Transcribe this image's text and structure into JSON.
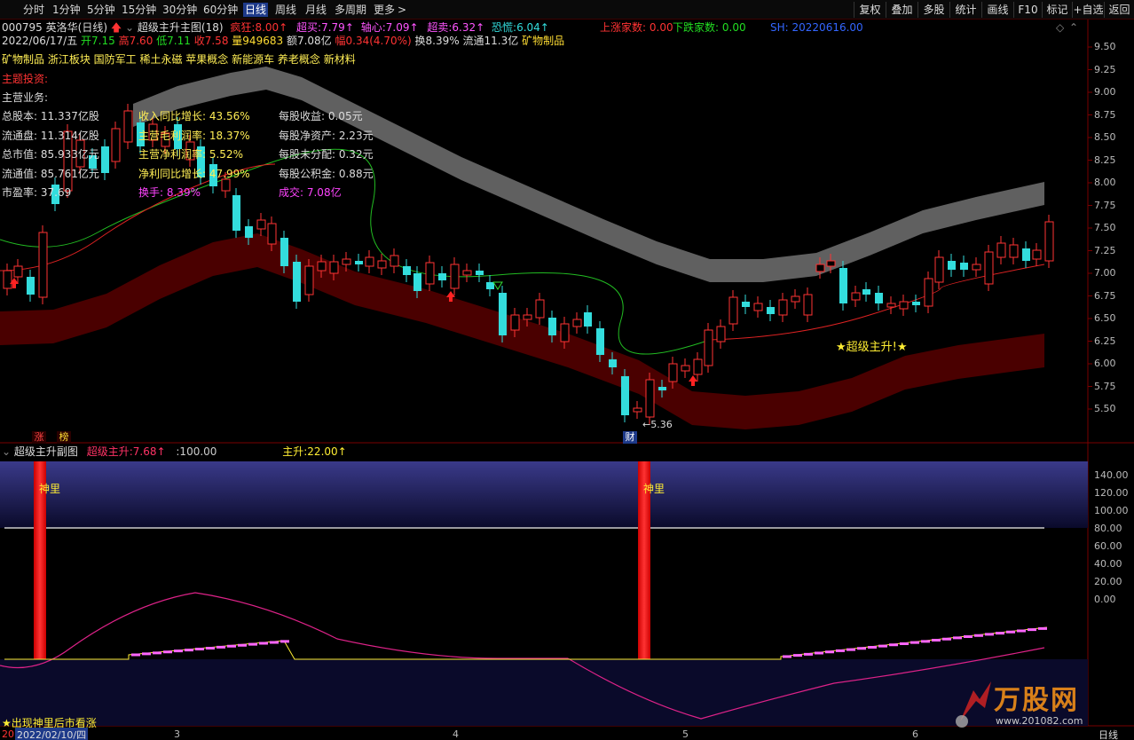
{
  "toolbar": {
    "timeframes": [
      "分时",
      "1分钟",
      "5分钟",
      "15分钟",
      "30分钟",
      "60分钟",
      "日线",
      "周线",
      "月线",
      "多周期",
      "更多"
    ],
    "active_timeframe": "日线",
    "more_arrow": ">",
    "buttons": [
      "复权",
      "叠加",
      "多股",
      "统计",
      "画线",
      "F10",
      "标记",
      "+自选",
      "返回"
    ]
  },
  "header": {
    "stock_code": "000795",
    "stock_name": "英洛华",
    "period": "(日线)",
    "indicator_name": "超级主升主图(18)",
    "crazy_label": "疯狂:",
    "crazy_value": "8.00",
    "super_buy_label": "超买:",
    "super_buy_value": "7.79",
    "axis_label": "轴心:",
    "axis_value": "7.09",
    "super_sell_label": "超卖:",
    "super_sell_value": "6.32",
    "panic_label": "恐慌:",
    "panic_value": "6.04",
    "up_count_label": "上涨家数:",
    "up_count_value": "0.00",
    "down_count_label": "下跌家数:",
    "down_count_value": "0.00",
    "sh_label": "SH:",
    "sh_value": "20220616.00"
  },
  "quote": {
    "date": "2022/06/17/五",
    "open": "开7.15",
    "high": "高7.60",
    "low": "低7.11",
    "close": "收7.58",
    "volume": "量949683",
    "amount": "额7.08亿",
    "change": "幅0.34(4.70%)",
    "turnover": "换8.39%",
    "float": "流通11.3亿",
    "industry": "矿物制品"
  },
  "concepts": "矿物制品 浙江板块 国防军工 稀土永磁 苹果概念 新能源车 养老概念 新材料",
  "fundamentals": {
    "theme_label": "主题投资:",
    "business_label": "主营业务:",
    "col1": [
      "总股本: 11.337亿股",
      "流通盘: 11.314亿股",
      "总市值: 85.933亿元",
      "流通值: 85.761亿元",
      "市盈率: 37.69"
    ],
    "col2": [
      "收入同比增长: 43.56%",
      "主营毛利润率: 18.37%",
      "主营净利润率: 5.52%",
      "净利同比增长: 47.99%",
      "换手: 8.39%"
    ],
    "col3": [
      "每股收益: 0.05元",
      "每股净资产: 2.23元",
      "每股未分配: 0.32元",
      "每股公积金: 0.88元",
      "成交: 7.08亿"
    ]
  },
  "price_axis": [
    "9.50",
    "9.25",
    "9.00",
    "8.75",
    "8.50",
    "8.25",
    "8.00",
    "7.75",
    "7.50",
    "7.25",
    "7.00",
    "6.75",
    "6.50",
    "6.25",
    "6.00",
    "5.75",
    "5.50"
  ],
  "annotations": {
    "low_marker": "←5.36",
    "super_rise_signal": "★超级主升!★",
    "cai_badge": "财",
    "zhang_badge": "涨",
    "bang_badge": "榜"
  },
  "sub_chart": {
    "title": "超级主升副图",
    "value1_label": "超级主升:",
    "value1": "7.68",
    "value2": ":100.00",
    "value3_label": "主升:",
    "value3": "22.00",
    "shenli_label": "神里",
    "footer_note": "★出现神里后市看涨",
    "axis": [
      "140.00",
      "120.00",
      "100.00",
      "80.00",
      "60.00",
      "40.00",
      "20.00",
      "0.00"
    ]
  },
  "x_axis": {
    "date_label": "2022/02/10/四",
    "prefix": "20",
    "months": [
      "3",
      "4",
      "5",
      "6"
    ]
  },
  "watermark": {
    "text": "万股网",
    "url": "www.201082.com"
  },
  "colors": {
    "up": "#ff3333",
    "down": "#33dddd",
    "gray_band": "#6a6a6a",
    "red_band": "#5a0000",
    "ma_green": "#22bb22",
    "ma_red": "#dd2222",
    "accent_blue": "#1e3a8a"
  }
}
